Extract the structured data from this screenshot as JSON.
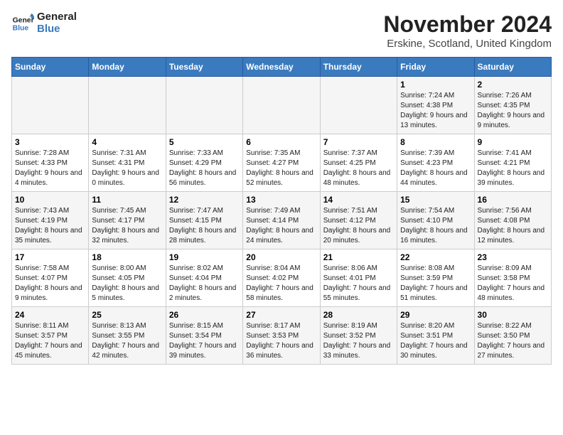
{
  "logo": {
    "line1": "General",
    "line2": "Blue"
  },
  "title": "November 2024",
  "subtitle": "Erskine, Scotland, United Kingdom",
  "days_of_week": [
    "Sunday",
    "Monday",
    "Tuesday",
    "Wednesday",
    "Thursday",
    "Friday",
    "Saturday"
  ],
  "weeks": [
    [
      {
        "day": "",
        "info": ""
      },
      {
        "day": "",
        "info": ""
      },
      {
        "day": "",
        "info": ""
      },
      {
        "day": "",
        "info": ""
      },
      {
        "day": "",
        "info": ""
      },
      {
        "day": "1",
        "info": "Sunrise: 7:24 AM\nSunset: 4:38 PM\nDaylight: 9 hours and 13 minutes."
      },
      {
        "day": "2",
        "info": "Sunrise: 7:26 AM\nSunset: 4:35 PM\nDaylight: 9 hours and 9 minutes."
      }
    ],
    [
      {
        "day": "3",
        "info": "Sunrise: 7:28 AM\nSunset: 4:33 PM\nDaylight: 9 hours and 4 minutes."
      },
      {
        "day": "4",
        "info": "Sunrise: 7:31 AM\nSunset: 4:31 PM\nDaylight: 9 hours and 0 minutes."
      },
      {
        "day": "5",
        "info": "Sunrise: 7:33 AM\nSunset: 4:29 PM\nDaylight: 8 hours and 56 minutes."
      },
      {
        "day": "6",
        "info": "Sunrise: 7:35 AM\nSunset: 4:27 PM\nDaylight: 8 hours and 52 minutes."
      },
      {
        "day": "7",
        "info": "Sunrise: 7:37 AM\nSunset: 4:25 PM\nDaylight: 8 hours and 48 minutes."
      },
      {
        "day": "8",
        "info": "Sunrise: 7:39 AM\nSunset: 4:23 PM\nDaylight: 8 hours and 44 minutes."
      },
      {
        "day": "9",
        "info": "Sunrise: 7:41 AM\nSunset: 4:21 PM\nDaylight: 8 hours and 39 minutes."
      }
    ],
    [
      {
        "day": "10",
        "info": "Sunrise: 7:43 AM\nSunset: 4:19 PM\nDaylight: 8 hours and 35 minutes."
      },
      {
        "day": "11",
        "info": "Sunrise: 7:45 AM\nSunset: 4:17 PM\nDaylight: 8 hours and 32 minutes."
      },
      {
        "day": "12",
        "info": "Sunrise: 7:47 AM\nSunset: 4:15 PM\nDaylight: 8 hours and 28 minutes."
      },
      {
        "day": "13",
        "info": "Sunrise: 7:49 AM\nSunset: 4:14 PM\nDaylight: 8 hours and 24 minutes."
      },
      {
        "day": "14",
        "info": "Sunrise: 7:51 AM\nSunset: 4:12 PM\nDaylight: 8 hours and 20 minutes."
      },
      {
        "day": "15",
        "info": "Sunrise: 7:54 AM\nSunset: 4:10 PM\nDaylight: 8 hours and 16 minutes."
      },
      {
        "day": "16",
        "info": "Sunrise: 7:56 AM\nSunset: 4:08 PM\nDaylight: 8 hours and 12 minutes."
      }
    ],
    [
      {
        "day": "17",
        "info": "Sunrise: 7:58 AM\nSunset: 4:07 PM\nDaylight: 8 hours and 9 minutes."
      },
      {
        "day": "18",
        "info": "Sunrise: 8:00 AM\nSunset: 4:05 PM\nDaylight: 8 hours and 5 minutes."
      },
      {
        "day": "19",
        "info": "Sunrise: 8:02 AM\nSunset: 4:04 PM\nDaylight: 8 hours and 2 minutes."
      },
      {
        "day": "20",
        "info": "Sunrise: 8:04 AM\nSunset: 4:02 PM\nDaylight: 7 hours and 58 minutes."
      },
      {
        "day": "21",
        "info": "Sunrise: 8:06 AM\nSunset: 4:01 PM\nDaylight: 7 hours and 55 minutes."
      },
      {
        "day": "22",
        "info": "Sunrise: 8:08 AM\nSunset: 3:59 PM\nDaylight: 7 hours and 51 minutes."
      },
      {
        "day": "23",
        "info": "Sunrise: 8:09 AM\nSunset: 3:58 PM\nDaylight: 7 hours and 48 minutes."
      }
    ],
    [
      {
        "day": "24",
        "info": "Sunrise: 8:11 AM\nSunset: 3:57 PM\nDaylight: 7 hours and 45 minutes."
      },
      {
        "day": "25",
        "info": "Sunrise: 8:13 AM\nSunset: 3:55 PM\nDaylight: 7 hours and 42 minutes."
      },
      {
        "day": "26",
        "info": "Sunrise: 8:15 AM\nSunset: 3:54 PM\nDaylight: 7 hours and 39 minutes."
      },
      {
        "day": "27",
        "info": "Sunrise: 8:17 AM\nSunset: 3:53 PM\nDaylight: 7 hours and 36 minutes."
      },
      {
        "day": "28",
        "info": "Sunrise: 8:19 AM\nSunset: 3:52 PM\nDaylight: 7 hours and 33 minutes."
      },
      {
        "day": "29",
        "info": "Sunrise: 8:20 AM\nSunset: 3:51 PM\nDaylight: 7 hours and 30 minutes."
      },
      {
        "day": "30",
        "info": "Sunrise: 8:22 AM\nSunset: 3:50 PM\nDaylight: 7 hours and 27 minutes."
      }
    ]
  ]
}
